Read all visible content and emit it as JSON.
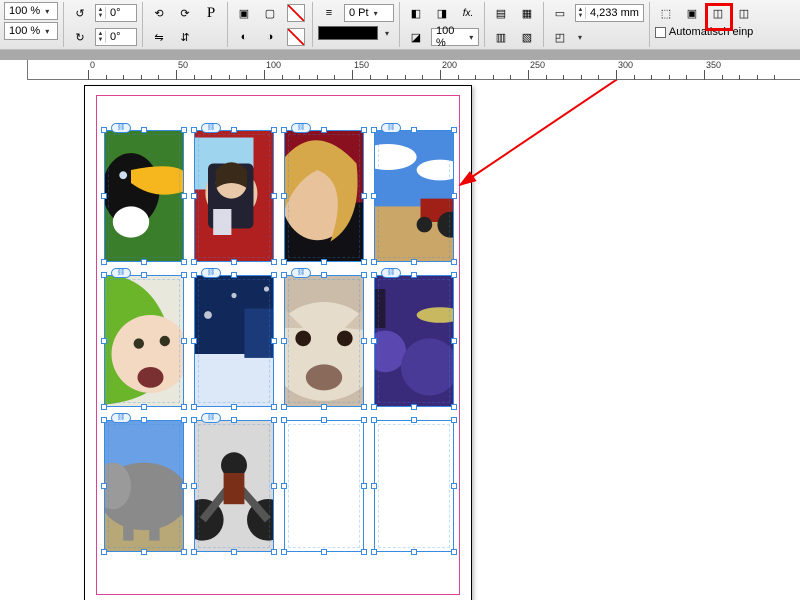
{
  "toolbar": {
    "zoom1": "100 %",
    "zoom2": "100 %",
    "rotate1": "0°",
    "rotate2": "0°",
    "stroke_weight": "0 Pt",
    "opacity": "100 %",
    "size_value": "4,233 mm",
    "autofit_label": "Automatisch einp",
    "icons": {
      "flip_h": "flip-horizontal-icon",
      "flip_v": "flip-vertical-icon",
      "select_container": "select-container-icon",
      "select_content": "select-content-icon",
      "char_P": "P",
      "clip_group": "group-icons",
      "stroke_none": "no-stroke",
      "fill_none": "no-fill",
      "fx": "fx.",
      "align_left": "align-left-icon",
      "align_center": "align-center-icon",
      "align_right": "align-right-icon",
      "fit": "fit-content-icon",
      "corner": "corner-icon",
      "frame_fit1": "fit-frame-prop-icon",
      "frame_fit2": "fill-frame-icon",
      "frame_fit3": "center-content-icon",
      "frame_fit4": "fit-frame-to-content-icon"
    }
  },
  "ruler": {
    "marks": [
      "0",
      "50",
      "100",
      "150",
      "200",
      "250",
      "300",
      "350"
    ]
  },
  "frames": [
    {
      "col": 0,
      "row": 0,
      "subject": "toucan"
    },
    {
      "col": 1,
      "row": 0,
      "subject": "woman-car-phone"
    },
    {
      "col": 2,
      "row": 0,
      "subject": "blonde-woman-red"
    },
    {
      "col": 3,
      "row": 0,
      "subject": "tractor-field-sky"
    },
    {
      "col": 0,
      "row": 1,
      "subject": "baby-green-hood"
    },
    {
      "col": 1,
      "row": 1,
      "subject": "snow-night-blue"
    },
    {
      "col": 2,
      "row": 1,
      "subject": "animal-closeup"
    },
    {
      "col": 3,
      "row": 1,
      "subject": "drums-purple"
    },
    {
      "col": 0,
      "row": 2,
      "subject": "elephant"
    },
    {
      "col": 1,
      "row": 2,
      "subject": "motorcycle-rider"
    },
    {
      "col": 2,
      "row": 2,
      "subject": "empty"
    },
    {
      "col": 3,
      "row": 2,
      "subject": "empty"
    }
  ],
  "annotation": {
    "highlight_target": "fit-frame-prop-button"
  }
}
